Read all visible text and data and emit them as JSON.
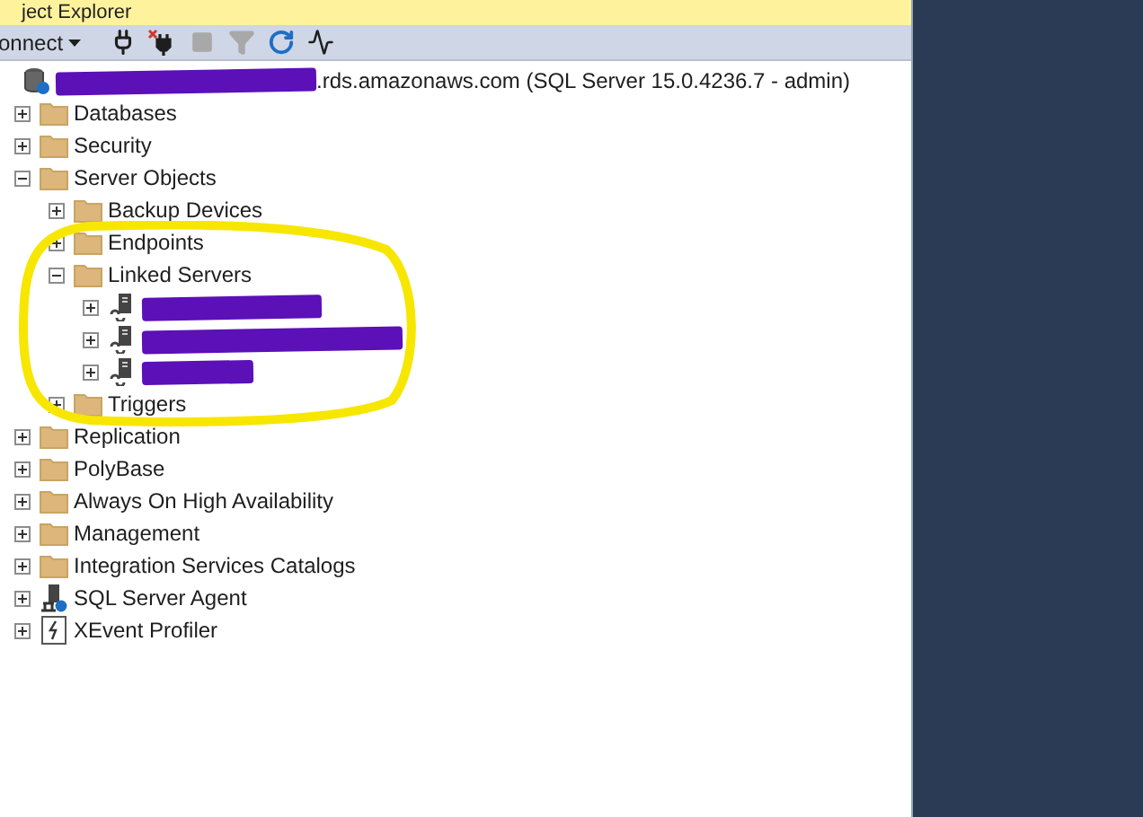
{
  "window": {
    "title": "ject Explorer"
  },
  "toolbar": {
    "connect": {
      "label": "onnect"
    },
    "tools": [
      {
        "kind": "connect",
        "disabled": false
      },
      {
        "kind": "disconnect",
        "disabled": false
      },
      {
        "kind": "stop",
        "disabled": true
      },
      {
        "kind": "filter",
        "disabled": true
      },
      {
        "kind": "refresh",
        "disabled": false
      },
      {
        "kind": "activity",
        "disabled": false
      }
    ]
  },
  "tree": [
    {
      "kind": "server",
      "label": ".rds.amazonaws.com (SQL Server 15.0.4236.7 - admin)",
      "redacted_prefix": true,
      "children": [
        {
          "kind": "folder",
          "label": "Databases",
          "expanded": false
        },
        {
          "kind": "folder",
          "label": "Security",
          "expanded": false
        },
        {
          "kind": "folder",
          "label": "Server Objects",
          "expanded": true,
          "children": [
            {
              "kind": "folder",
              "label": "Backup Devices",
              "expanded": false
            },
            {
              "kind": "folder",
              "label": "Endpoints",
              "expanded": false
            },
            {
              "kind": "folder",
              "label": "Linked Servers",
              "expanded": true,
              "children": [
                {
                  "kind": "linked-server",
                  "redacted_prefix": true,
                  "expanded": false
                },
                {
                  "kind": "linked-server",
                  "redacted_prefix": true,
                  "expanded": false
                },
                {
                  "kind": "linked-server",
                  "redacted_prefix": true,
                  "expanded": false
                }
              ]
            },
            {
              "kind": "folder",
              "label": "Triggers",
              "expanded": false
            }
          ]
        },
        {
          "kind": "folder",
          "label": "Replication",
          "expanded": false
        },
        {
          "kind": "folder",
          "label": "PolyBase",
          "expanded": false
        },
        {
          "kind": "folder",
          "label": "Always On High Availability",
          "expanded": false
        },
        {
          "kind": "folder",
          "label": "Management",
          "expanded": false
        },
        {
          "kind": "folder",
          "label": "Integration Services Catalogs",
          "expanded": false
        },
        {
          "kind": "agent",
          "label": "SQL Server Agent",
          "expanded": false
        },
        {
          "kind": "xevent",
          "label": "XEvent Profiler",
          "expanded": false
        }
      ]
    }
  ],
  "annotation": {
    "kind": "highlight-ring"
  }
}
